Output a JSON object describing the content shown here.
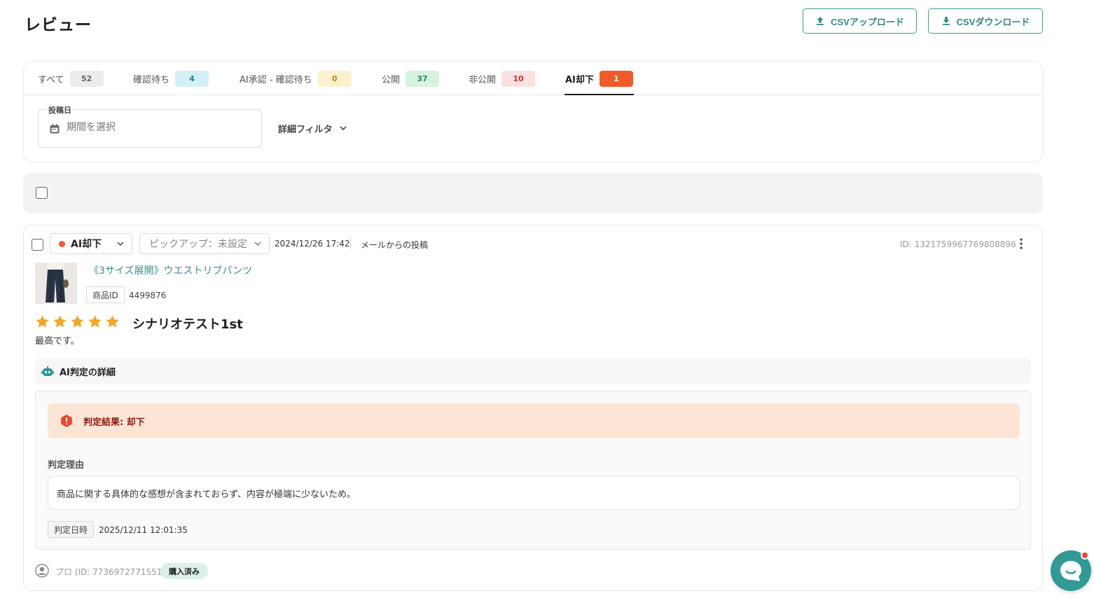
{
  "page": {
    "title": "レビュー"
  },
  "header": {
    "upload_label": "CSVアップロード",
    "download_label": "CSVダウンロード"
  },
  "tabs": [
    {
      "label": "すべて",
      "count": "52",
      "badge_bg": "#ececec",
      "badge_fg": "#666666"
    },
    {
      "label": "確認待ち",
      "count": "4",
      "badge_bg": "#d4f0f7",
      "badge_fg": "#2a7f95"
    },
    {
      "label": "AI承認 - 確認待ち",
      "count": "0",
      "badge_bg": "#fdf0cf",
      "badge_fg": "#b98412"
    },
    {
      "label": "公開",
      "count": "37",
      "badge_bg": "#d6f2e0",
      "badge_fg": "#2f8a4f"
    },
    {
      "label": "非公開",
      "count": "10",
      "badge_bg": "#fde0e0",
      "badge_fg": "#c4332e"
    },
    {
      "label": "AI却下",
      "count": "1",
      "badge_bg": "#f15a29",
      "badge_fg": "#ffffff"
    }
  ],
  "active_tab": "AI却下",
  "filters": {
    "date_label": "投稿日",
    "date_placeholder": "期間を選択",
    "advanced_label": "詳細フィルタ"
  },
  "review": {
    "status": "AI却下",
    "status_color": "#f15a29",
    "pickup": "ピックアップ：未設定",
    "datetime": "2024/12/26 17:42",
    "source": "メールからの投稿",
    "id_text": "ID: 1321759967769808896",
    "product_name": "《3サイズ展開》ウエストリブパンツ",
    "product_id_label": "商品ID",
    "product_id": "4499876",
    "rating": 5,
    "title": "シナリオテスト1st",
    "body": "最高です。",
    "ai_section_title": "AI判定の詳細",
    "verdict": "判定結果: 却下",
    "reason_label": "判定理由",
    "reason": "商品に関する具体的な感想が含まれておらず、内容が極端に少ないため。",
    "judged_at_label": "判定日時",
    "judged_at": "2025/12/11 12:01:35",
    "author": "プロ (ID: 7736972771551)",
    "purchased": "購入済み"
  },
  "colors": {
    "accent": "#2f9a96",
    "star": "#f5a623",
    "danger": "#f15a29"
  }
}
